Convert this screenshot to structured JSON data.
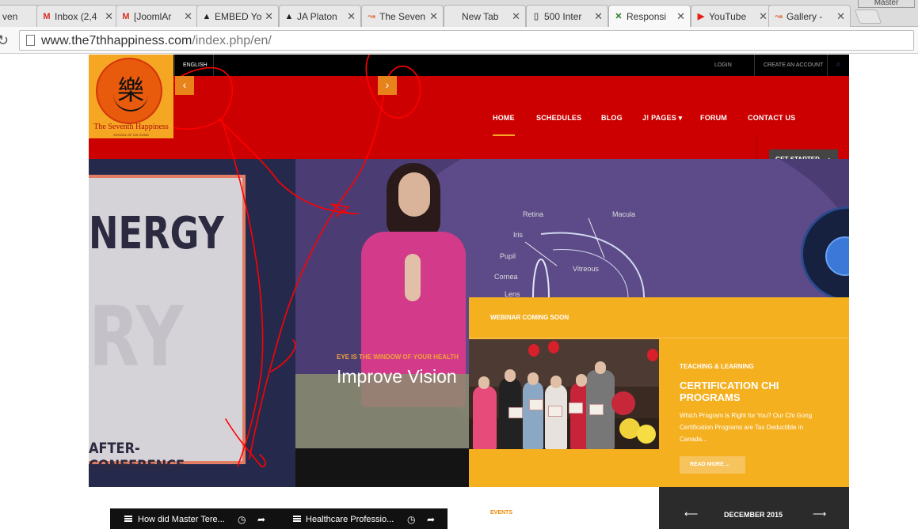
{
  "browser": {
    "tabs": [
      {
        "label": "ven",
        "icon": "",
        "icon_color": "#888888",
        "active": false
      },
      {
        "label": "Inbox (2,4",
        "icon": "M",
        "icon_color": "#d93025",
        "active": false
      },
      {
        "label": "[JoomlAr",
        "icon": "M",
        "icon_color": "#d93025",
        "active": false
      },
      {
        "label": "EMBED Yo",
        "icon": "▲",
        "icon_color": "#222222",
        "active": false
      },
      {
        "label": "JA Platon",
        "icon": "▲",
        "icon_color": "#222222",
        "active": false
      },
      {
        "label": "The Seven",
        "icon": "↝",
        "icon_color": "#e07a4a",
        "active": false
      },
      {
        "label": "New Tab",
        "icon": "",
        "icon_color": "#888888",
        "active": false
      },
      {
        "label": "500 Inter",
        "icon": "▯",
        "icon_color": "#666666",
        "active": false
      },
      {
        "label": "Responsi",
        "icon": "✕",
        "icon_color": "#2a7a2a",
        "active": true
      },
      {
        "label": "YouTube",
        "icon": "▶",
        "icon_color": "#e62117",
        "active": false
      },
      {
        "label": "Gallery -",
        "icon": "↝",
        "icon_color": "#e07a4a",
        "active": false
      }
    ],
    "profile": "Master",
    "url_host": "www.the7thhappiness.com",
    "url_path": "/index.php/en/"
  },
  "site": {
    "language": "ENGLISH",
    "login": "LOGIN",
    "create_account": "CREATE AN ACCOUNT",
    "logo": {
      "char": "樂",
      "name": "The Seventh Happiness",
      "sub": "SCHOOL OF CHI GONG"
    },
    "nav": [
      {
        "label": "HOME",
        "active": true
      },
      {
        "label": "SCHEDULES",
        "active": false
      },
      {
        "label": "BLOG",
        "active": false
      },
      {
        "label": "J! PAGES ▾",
        "active": false
      },
      {
        "label": "FORUM",
        "active": false
      },
      {
        "label": "CONTACT US",
        "active": false
      }
    ],
    "get_started": "GET STARTED ⟶",
    "prev_arrow": "‹",
    "next_arrow": "›",
    "hero_left": {
      "energy": "NERGY",
      "ry": "RY",
      "after": "AFTER-CONFERENCE"
    },
    "hero_main": {
      "eyebrow": "EYE IS THE WINDOW OF YOUR HEALTH",
      "title": "Improve Vision",
      "diagram_labels": {
        "retina": "Retina",
        "macula": "Macula",
        "iris": "Iris",
        "pupil": "Pupil",
        "cornea": "Cornea",
        "vitreous": "Vitreous",
        "lens": "Lens"
      }
    },
    "webinar": {
      "heading": "WEBINAR COMING SOON",
      "category": "TEACHING & LEARNING",
      "title": "CERTIFICATION CHI PROGRAMS",
      "description": "Which Program is Right for You? Our Chi Gong Certification Programs are Tax Deductible in Canada...",
      "read_more": "READ MORE ..."
    },
    "videos": [
      {
        "title": "How did Master Tere..."
      },
      {
        "title": "Healthcare Professio..."
      }
    ],
    "events_label": "EVENTS",
    "calendar": {
      "month": "DECEMBER 2015",
      "prev": "⟵",
      "next": "⟶"
    }
  },
  "colors": {
    "site_red": "#cc0000",
    "accent_orange": "#f5b020",
    "annotation_ink": "#ff0000"
  }
}
